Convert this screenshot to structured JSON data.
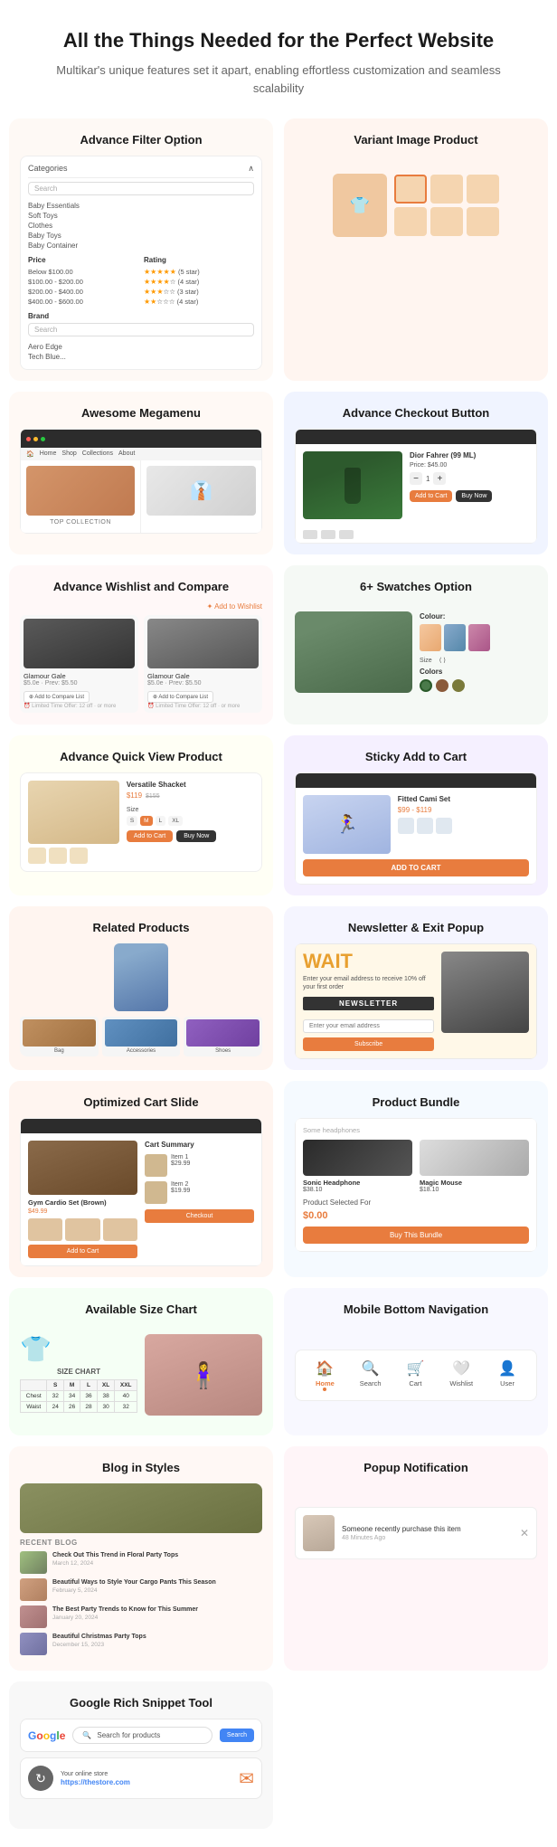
{
  "header": {
    "title": "All the Things Needed for the Perfect Website",
    "subtitle": "Multikar's unique features set it apart, enabling effortless customization and seamless scalability"
  },
  "features": {
    "advance_filter": {
      "title": "Advance Filter Option",
      "categories_label": "Categories",
      "search_placeholder": "Search",
      "category_items": [
        "Baby Essentials",
        "Soft Toys",
        "Clothes",
        "Baby Toys",
        "Baby Container"
      ],
      "price_label": "Price",
      "price_items": [
        "Below $100.00",
        "$100.00 - $200.00",
        "$200.00 - $400.00",
        "$400.00 - $600.00"
      ],
      "brand_label": "Brand",
      "rating_label": "Rating"
    },
    "variant_image": {
      "title": "Variant Image Product"
    },
    "megamenu": {
      "title": "Awesome Megamenu",
      "collection_label": "TOP COLLECTION"
    },
    "checkout": {
      "title": "Advance Checkout Button",
      "product_name": "Dior Fahrer (99 ML)",
      "add_to_cart": "Add to Cart",
      "buy_now": "Buy Now"
    },
    "wishlist": {
      "title": "Advance Wishlist and Compare",
      "add_to_wishlist": "Add to Wishlist",
      "add_to_compare": "Add to Compare List",
      "product1_name": "Glamour Gale",
      "product2_name": "Glamour Gale",
      "badge": "Add to Wishlist"
    },
    "swatches": {
      "title": "6+ Swatches Option",
      "colour_label": "Colour:",
      "color_label": "Colors"
    },
    "quickview": {
      "title": "Advance Quick View Product",
      "product_name": "Versatile Shacket",
      "price": "$119",
      "old_price": "$155",
      "size_label": "Size",
      "sizes": [
        "S",
        "M",
        "L",
        "XL"
      ],
      "add_to_cart": "Add to Cart",
      "buy_now": "Buy Now"
    },
    "sticky_cart": {
      "title": "Sticky Add to Cart",
      "product_name": "Fitted Cami Set",
      "price": "$99 - $119",
      "add_to_cart_bar": "ADD TO CART"
    },
    "related_products": {
      "title": "Related Products"
    },
    "newsletter": {
      "title": "Newsletter & Exit Popup",
      "wait_text": "WAIT",
      "subtitle": "Enter your email address to receive 10% off your first order",
      "badge": "NEWSLETTER",
      "email_placeholder": "Enter your email address",
      "subscribe_btn": "Subscribe"
    },
    "cart_slide": {
      "title": "Optimized Cart Slide",
      "product_name": "Gym Cardio Set (Brown)",
      "add_to_cart": "Add to Cart",
      "checkout": "Checkout"
    },
    "product_bundle": {
      "title": "Product Bundle",
      "subtitle": "Some headphones",
      "product1_name": "Sonic Headphone",
      "product1_price": "$38.10",
      "product2_name": "Magic Mouse",
      "product2_price": "$18.10",
      "selected_label": "Product Selected For",
      "total_price": "$0.00",
      "btn_label": "Buy This Bundle"
    },
    "size_chart": {
      "title": "Available Size Chart",
      "chart_title": "SIZE CHART",
      "headers": [
        "S",
        "M",
        "L",
        "XL",
        "XXL"
      ],
      "rows": [
        [
          "32",
          "34",
          "36",
          "38",
          "40"
        ],
        [
          "24",
          "26",
          "28",
          "30",
          "32"
        ]
      ],
      "row_labels": [
        "Chest",
        "Waist"
      ]
    },
    "mobile_nav": {
      "title": "Mobile Bottom Navigation",
      "items": [
        "Home",
        "Search",
        "Cart",
        "Wishlist",
        "User"
      ],
      "active_item": "Home"
    },
    "blog": {
      "title": "Blog in Styles",
      "section_label": "Recent Blog",
      "posts": [
        {
          "title": "Check Out This Trend in Floral Party Tops",
          "date": "March 12, 2024"
        },
        {
          "title": "Beautiful Ways to Style Your Cargo Pants This Season",
          "date": "February 5, 2024"
        },
        {
          "title": "The Best Party Trends to Know for This Summer",
          "date": "January 20, 2024"
        },
        {
          "title": "Beautiful Christmas Party Tops",
          "date": "December 15, 2023"
        }
      ]
    },
    "popup": {
      "title": "Popup Notification",
      "text": "Someone recently purchase this item",
      "time": "48 Minutes Ago"
    },
    "snippet": {
      "title": "Google Rich Snippet Tool",
      "search_placeholder": "Search for products",
      "search_btn": "Search",
      "store_label": "Your online store",
      "store_url": "https://thestore.com"
    }
  }
}
